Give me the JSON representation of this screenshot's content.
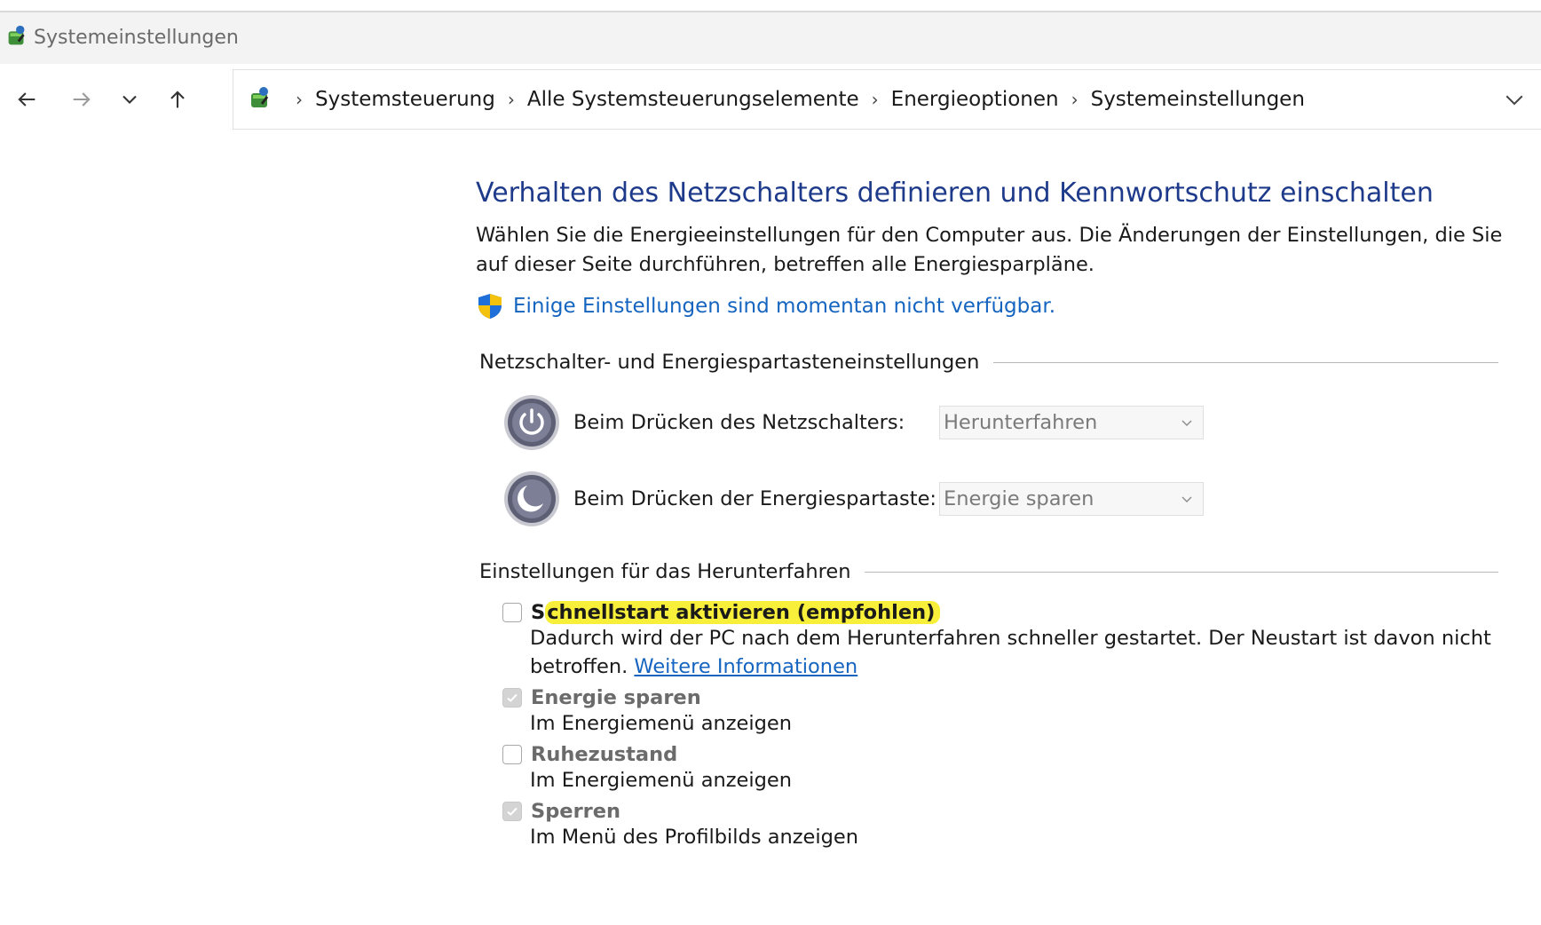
{
  "window": {
    "title": "Systemeinstellungen"
  },
  "breadcrumbs": [
    "Systemsteuerung",
    "Alle Systemsteuerungselemente",
    "Energieoptionen",
    "Systemeinstellungen"
  ],
  "main": {
    "heading": "Verhalten des Netzschalters definieren und Kennwortschutz einschalten",
    "description": "Wählen Sie die Energieeinstellungen für den Computer aus. Die Änderungen der Einstellungen, die Sie auf dieser Seite durchführen, betreffen alle Energiesparpläne.",
    "uac_link": "Einige Einstellungen sind momentan nicht verfügbar.",
    "power_group": {
      "title": "Netzschalter- und Energiespartasteneinstellungen",
      "power_button_label": "Beim Drücken des Netzschalters:",
      "power_button_value": "Herunterfahren",
      "sleep_button_label": "Beim Drücken der Energiespartaste:",
      "sleep_button_value": "Energie sparen"
    },
    "shutdown_group": {
      "title": "Einstellungen für das Herunterfahren",
      "fast_startup": {
        "first_letter": "S",
        "label_rest": "chnellstart aktivieren (empfohlen)",
        "desc": "Dadurch wird der PC nach dem Herunterfahren schneller gestartet. Der Neustart ist davon nicht betroffen.",
        "link": "Weitere Informationen",
        "checked": false
      },
      "sleep": {
        "label": "Energie sparen",
        "desc": "Im Energiemenü anzeigen",
        "checked": true
      },
      "hibernate": {
        "label": "Ruhezustand",
        "desc": "Im Energiemenü anzeigen",
        "checked": false
      },
      "lock": {
        "label": "Sperren",
        "desc": "Im Menü des Profilbilds anzeigen",
        "checked": true
      }
    }
  }
}
